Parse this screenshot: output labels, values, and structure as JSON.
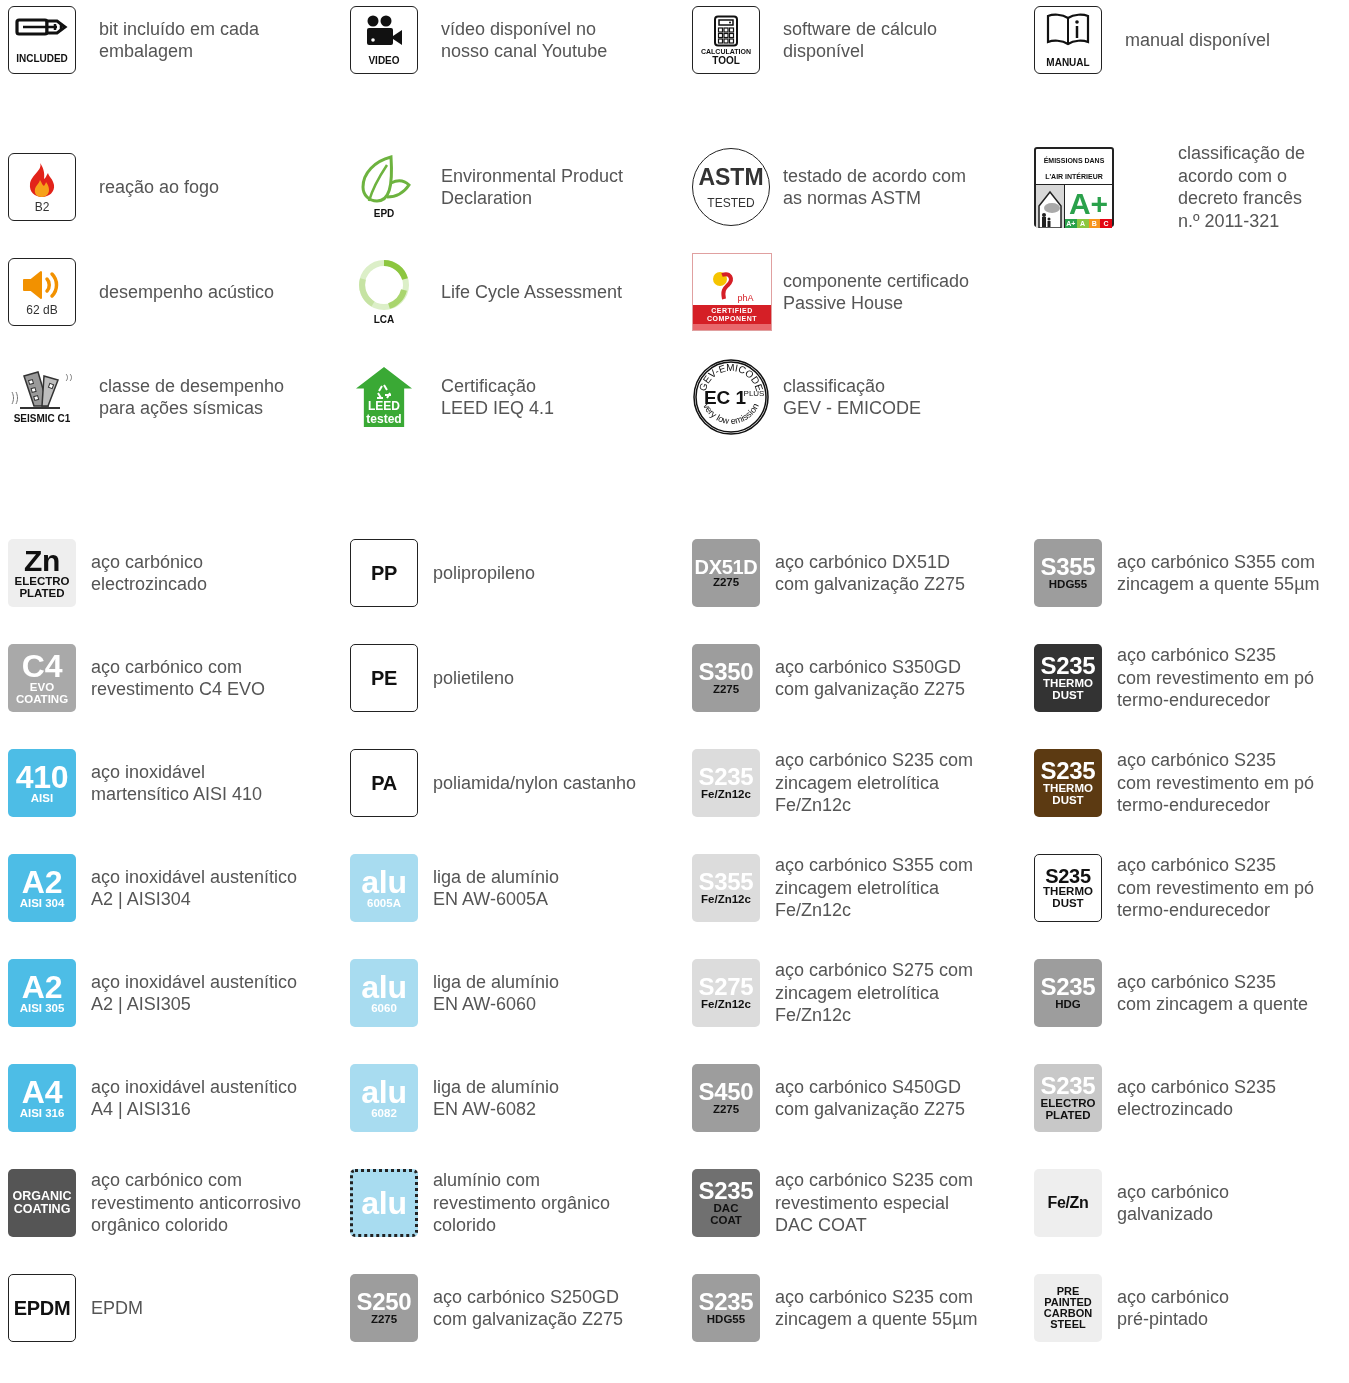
{
  "symbols": [
    [
      {
        "kind": "included",
        "labels": [
          "INCLUDED"
        ],
        "text": "bit incluído em cada\nembalagem"
      },
      {
        "kind": "video",
        "labels": [
          "VIDEO"
        ],
        "text": "vídeo disponível no\nnosso canal Youtube"
      },
      {
        "kind": "calculation",
        "labels": [
          "CALCULATION",
          "TOOL"
        ],
        "text": "software de cálculo\ndisponível"
      },
      {
        "kind": "manual",
        "labels": [
          "MANUAL"
        ],
        "text": "manual disponível"
      }
    ],
    [
      {
        "kind": "fire",
        "labels": [
          "B2"
        ],
        "text": "reação ao fogo"
      },
      {
        "kind": "epd",
        "labels": [
          "EPD"
        ],
        "text": "Environmental Product\nDeclaration"
      },
      {
        "kind": "astm",
        "labels": [
          "ASTM",
          "TESTED"
        ],
        "text": "testado de acordo com\nas normas ASTM"
      },
      {
        "kind": "emissions",
        "labels": [
          "ÉMISSIONS DANS L'AIR INTÉRIEUR",
          "A+",
          "A+",
          "A",
          "B",
          "C"
        ],
        "text": "classificação de\nacordo com o\ndecreto francês\nn.º 2011-321"
      }
    ],
    [
      {
        "kind": "sound",
        "labels": [
          "62 dB"
        ],
        "text": "desempenho acústico"
      },
      {
        "kind": "lca",
        "labels": [
          "LCA"
        ],
        "text": "Life Cycle Assessment"
      },
      {
        "kind": "passive",
        "labels": [
          "phA",
          "CERTIFIED",
          "COMPONENT"
        ],
        "text": "componente certificado\nPassive House"
      }
    ],
    [
      {
        "kind": "seismic",
        "labels": [
          "SEISMIC C1"
        ],
        "text": "classe de desempenho\npara ações sísmicas"
      },
      {
        "kind": "leed",
        "labels": [
          "LEED",
          "tested"
        ],
        "text": "Certificação\nLEED IEQ 4.1"
      },
      {
        "kind": "emicode",
        "labels": [
          "GEV-EMICODE",
          "EC 1",
          "PLUS",
          "very low emission"
        ],
        "text": "classificação\nGEV - EMICODE"
      }
    ]
  ],
  "materials": [
    {
      "kind": "light",
      "color": "#eeeeee",
      "code": "Zn",
      "sub": [
        "ELECTRO",
        "PLATED"
      ],
      "text": "aço carbónico\nelectrozincado"
    },
    {
      "kind": "outline",
      "code": "PP",
      "text": "polipropileno"
    },
    {
      "kind": "mixed",
      "color": "#9d9d9d",
      "code": "DX51D",
      "sub": [
        "Z275"
      ],
      "text": "aço carbónico DX51D\ncom galvanização Z275"
    },
    {
      "kind": "mixed",
      "color": "#9d9d9d",
      "code": "S355",
      "sub": [
        "HDG55"
      ],
      "text": "aço carbónico S355 com\nzincagem a quente 55µm"
    },
    {
      "kind": "solid",
      "color": "#a9a9a9",
      "code": "C4",
      "sub": [
        "EVO",
        "COATING"
      ],
      "text": "aço carbónico com\nrevestimento C4 EVO"
    },
    {
      "kind": "outline",
      "code": "PE",
      "text": "polietileno"
    },
    {
      "kind": "mixed",
      "color": "#9d9d9d",
      "code": "S350",
      "sub": [
        "Z275"
      ],
      "text": "aço carbónico S350GD\ncom galvanização Z275"
    },
    {
      "kind": "solid",
      "color": "#333333",
      "code": "S235",
      "sub": [
        "THERMO",
        "DUST"
      ],
      "text": "aço carbónico S235\ncom revestimento em pó\ntermo-endurecedor"
    },
    {
      "kind": "solid",
      "color": "#4dbde6",
      "code": "410",
      "sub": [
        "AISI"
      ],
      "text": "aço inoxidável\nmartensítico AISI 410"
    },
    {
      "kind": "outline",
      "code": "PA",
      "text": "poliamida/nylon castanho"
    },
    {
      "kind": "mixed",
      "color": "#dcdcdc",
      "code": "S235",
      "sub": [
        "Fe/Zn12c"
      ],
      "text": "aço carbónico S235 com\nzincagem eletrolítica\nFe/Zn12c"
    },
    {
      "kind": "solid",
      "color": "#5c3a12",
      "code": "S235",
      "sub": [
        "THERMO",
        "DUST"
      ],
      "text": "aço carbónico S235\ncom revestimento em pó\ntermo-endurecedor"
    },
    {
      "kind": "solid",
      "color": "#4dbde6",
      "code": "A2",
      "sub": [
        "AISI 304"
      ],
      "text": "aço inoxidável austenítico\nA2 | AISI304"
    },
    {
      "kind": "solid",
      "color": "#a8dcf0",
      "code": "alu",
      "sub": [
        "6005A"
      ],
      "text": "liga de alumínio\nEN AW-6005A"
    },
    {
      "kind": "mixed",
      "color": "#dcdcdc",
      "code": "S355",
      "sub": [
        "Fe/Zn12c"
      ],
      "text": "aço carbónico S355 com\nzincagem eletrolítica\nFe/Zn12c"
    },
    {
      "kind": "outline",
      "code": "S235",
      "sub": [
        "THERMO",
        "DUST"
      ],
      "text": "aço carbónico S235\ncom revestimento em pó\ntermo-endurecedor"
    },
    {
      "kind": "solid",
      "color": "#4dbde6",
      "code": "A2",
      "sub": [
        "AISI 305"
      ],
      "text": "aço inoxidável austenítico\nA2 | AISI305"
    },
    {
      "kind": "solid",
      "color": "#a8dcf0",
      "code": "alu",
      "sub": [
        "6060"
      ],
      "text": "liga de alumínio\nEN AW-6060"
    },
    {
      "kind": "mixed",
      "color": "#dcdcdc",
      "code": "S275",
      "sub": [
        "Fe/Zn12c"
      ],
      "text": "aço carbónico S275 com\nzincagem eletrolítica\nFe/Zn12c"
    },
    {
      "kind": "mixed",
      "color": "#9d9d9d",
      "code": "S235",
      "sub": [
        "HDG"
      ],
      "text": "aço carbónico S235\ncom zincagem a quente"
    },
    {
      "kind": "solid",
      "color": "#4dbde6",
      "code": "A4",
      "sub": [
        "AISI 316"
      ],
      "text": "aço inoxidável austenítico\nA4 | AISI316"
    },
    {
      "kind": "solid",
      "color": "#a8dcf0",
      "code": "alu",
      "sub": [
        "6082"
      ],
      "text": "liga de alumínio\nEN AW-6082"
    },
    {
      "kind": "mixed",
      "color": "#9d9d9d",
      "code": "S450",
      "sub": [
        "Z275"
      ],
      "text": "aço carbónico S450GD\ncom galvanização Z275"
    },
    {
      "kind": "mixed",
      "color": "#c8c8c8",
      "code": "S235",
      "sub": [
        "ELECTRO",
        "PLATED"
      ],
      "text": "aço carbónico S235\nelectrozincado"
    },
    {
      "kind": "solid",
      "color": "#555555",
      "sub": [
        "ORGANIC",
        "COATING"
      ],
      "text": "aço carbónico com\nrevestimento anticorrosivo\norgânico colorido"
    },
    {
      "kind": "dashed",
      "color": "#a8dcf0",
      "code": "alu",
      "text": "alumínio com\nrevestimento orgânico\ncolorido"
    },
    {
      "kind": "mixed",
      "color": "#707070",
      "code": "S235",
      "sub": [
        "DAC",
        "COAT"
      ],
      "text": "aço carbónico S235 com\nrevestimento especial\nDAC COAT"
    },
    {
      "kind": "light",
      "color": "#eeeeee",
      "code": "Fe/Zn",
      "text": "aço carbónico\ngalvanizado"
    },
    {
      "kind": "outline",
      "code": "EPDM",
      "text": "EPDM"
    },
    {
      "kind": "mixed",
      "color": "#9d9d9d",
      "code": "S250",
      "sub": [
        "Z275"
      ],
      "text": "aço carbónico S250GD\ncom galvanização Z275"
    },
    {
      "kind": "mixed",
      "color": "#9d9d9d",
      "code": "S235",
      "sub": [
        "HDG55"
      ],
      "text": "aço carbónico S235 com\nzincagem a quente 55µm"
    },
    {
      "kind": "light",
      "color": "#eeeeee",
      "sub": [
        "PRE",
        "PAINTED",
        "CARBON",
        "STEEL"
      ],
      "text": "aço carbónico\npré-pintado"
    }
  ]
}
